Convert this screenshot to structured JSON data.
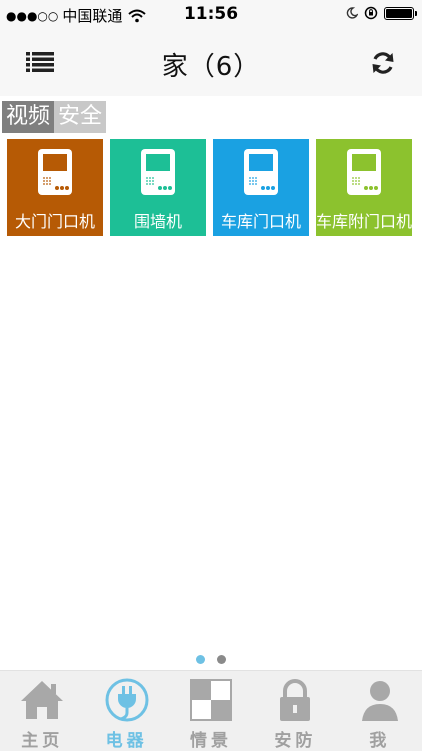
{
  "status": {
    "signal": "●●●○○",
    "carrier": "中国联通",
    "time": "11:56"
  },
  "nav": {
    "title": "家（6）",
    "menu_icon": "list-icon",
    "refresh_icon": "refresh-icon"
  },
  "tabs": [
    {
      "label": "视频",
      "active": true
    },
    {
      "label": "安全",
      "active": false
    }
  ],
  "tiles": [
    {
      "label": "大门门口机",
      "color": "#b65a05",
      "icon": "doorphone-icon"
    },
    {
      "label": "围墙机",
      "color": "#1dbf96",
      "icon": "doorphone-icon"
    },
    {
      "label": "车库门口机",
      "color": "#1aa1e2",
      "icon": "doorphone-icon"
    },
    {
      "label": "车库附门口机",
      "color": "#8cc22e",
      "icon": "doorphone-icon"
    }
  ],
  "pager": {
    "active_color": "#6ec1e4",
    "inactive_color": "#8a8a8a",
    "pages": 2,
    "current": 1
  },
  "tabbar": [
    {
      "label": "主页",
      "icon": "home-icon",
      "active": false
    },
    {
      "label": "电器",
      "icon": "plug-icon",
      "active": true
    },
    {
      "label": "情景",
      "icon": "scene-icon",
      "active": false
    },
    {
      "label": "安防",
      "icon": "lock-icon",
      "active": false
    },
    {
      "label": "我",
      "icon": "user-icon",
      "active": false
    }
  ]
}
